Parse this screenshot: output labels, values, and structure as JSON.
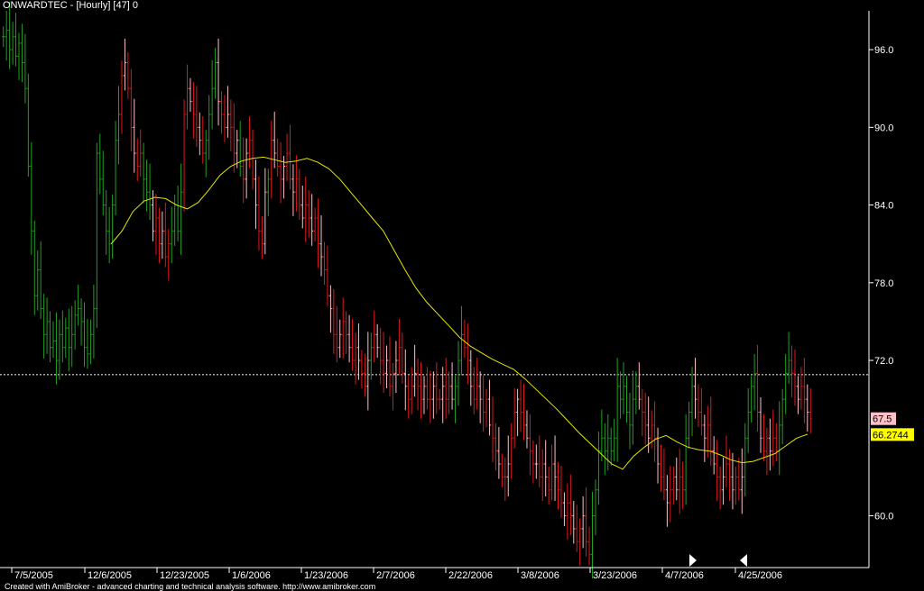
{
  "title": "ONWARDTEC - [Hourly]  [47] 0",
  "footer": "Created with AmiBroker - advanced charting and technical analysis software. http://www.amibroker.com",
  "colors": {
    "up": "#1fa01f",
    "down": "#e01818",
    "down_light": "#ffc0c8",
    "ma": "#e6e600",
    "axis": "#ffffff",
    "dotted": "#ffffff"
  },
  "chart_data": {
    "type": "line",
    "ylim": [
      56.0,
      99.0
    ],
    "yticks": [
      "96.0",
      "90.0",
      "84.0",
      "78.0",
      "72.0",
      "60.0"
    ],
    "yticks_values": [
      96.0,
      90.0,
      84.0,
      78.0,
      72.0,
      60.0
    ],
    "xticks": [
      "7/5/2005",
      "12/6/2005",
      "12/23/2005",
      "1/6/2006",
      "1/23/2006",
      "2/7/2006",
      "2/22/2006",
      "3/8/2006",
      "3/23/2006",
      "4/7/2006",
      "4/25/2006"
    ],
    "reference_line": 70.9,
    "last_close": "67.5",
    "last_ma": "66.2744",
    "series": [
      {
        "kind": "price",
        "points": [
          [
            97,
            "u"
          ],
          [
            97.5,
            "u"
          ],
          [
            96,
            "u"
          ],
          [
            97,
            "u"
          ],
          [
            95.5,
            "u"
          ],
          [
            96.5,
            "u"
          ],
          [
            95,
            "u"
          ],
          [
            93,
            "u"
          ],
          [
            87,
            "u"
          ],
          [
            82,
            "u"
          ],
          [
            77,
            "u"
          ],
          [
            79,
            "u"
          ],
          [
            76,
            "u"
          ],
          [
            74,
            "u"
          ],
          [
            75,
            "u"
          ],
          [
            73,
            "u"
          ],
          [
            73.5,
            "u"
          ],
          [
            72,
            "u"
          ],
          [
            74,
            "u"
          ],
          [
            73,
            "u"
          ],
          [
            74.5,
            "u"
          ],
          [
            73,
            "u"
          ],
          [
            74,
            "u"
          ],
          [
            75.5,
            "u"
          ],
          [
            76,
            "u"
          ],
          [
            75,
            "u"
          ],
          [
            73,
            "u"
          ],
          [
            72.5,
            "u"
          ],
          [
            74,
            "u"
          ],
          [
            76,
            "u"
          ],
          [
            88,
            "u"
          ],
          [
            86,
            "u"
          ],
          [
            84,
            "u"
          ],
          [
            82,
            "u"
          ],
          [
            81,
            "u"
          ],
          [
            84,
            "u"
          ],
          [
            89,
            "u"
          ],
          [
            91,
            "u"
          ],
          [
            94,
            "d"
          ],
          [
            95,
            "d"
          ],
          [
            93,
            "d"
          ],
          [
            90,
            "d"
          ],
          [
            88,
            "d"
          ],
          [
            87,
            "d"
          ],
          [
            88,
            "d"
          ],
          [
            86,
            "u"
          ],
          [
            85,
            "u"
          ],
          [
            84,
            "u"
          ],
          [
            82,
            "d"
          ],
          [
            83,
            "d"
          ],
          [
            81,
            "d"
          ],
          [
            82,
            "d"
          ],
          [
            80,
            "d"
          ],
          [
            81,
            "d"
          ],
          [
            82,
            "u"
          ],
          [
            84,
            "u"
          ],
          [
            82,
            "u"
          ],
          [
            85,
            "u"
          ],
          [
            91,
            "d"
          ],
          [
            93,
            "d"
          ],
          [
            92,
            "d"
          ],
          [
            91,
            "d"
          ],
          [
            90,
            "d"
          ],
          [
            89,
            "d"
          ],
          [
            88,
            "d"
          ],
          [
            89,
            "u"
          ],
          [
            91,
            "u"
          ],
          [
            93,
            "u"
          ],
          [
            95,
            "u"
          ],
          [
            92,
            "d"
          ],
          [
            91,
            "d"
          ],
          [
            90,
            "d"
          ],
          [
            91,
            "d"
          ],
          [
            90,
            "d"
          ],
          [
            88,
            "d"
          ],
          [
            89,
            "d"
          ],
          [
            87,
            "u"
          ],
          [
            86,
            "d"
          ],
          [
            88,
            "d"
          ],
          [
            89,
            "d"
          ],
          [
            86,
            "d"
          ],
          [
            84,
            "d"
          ],
          [
            82,
            "d"
          ],
          [
            81,
            "d"
          ],
          [
            85,
            "d"
          ],
          [
            86,
            "u"
          ],
          [
            89,
            "d"
          ],
          [
            88,
            "d"
          ],
          [
            87,
            "d"
          ],
          [
            86,
            "d"
          ],
          [
            87,
            "d"
          ],
          [
            88,
            "d"
          ],
          [
            86,
            "d"
          ],
          [
            85,
            "d"
          ],
          [
            86,
            "d"
          ],
          [
            84,
            "d"
          ],
          [
            83,
            "d"
          ],
          [
            84,
            "d"
          ],
          [
            83,
            "d"
          ],
          [
            82,
            "d"
          ],
          [
            83,
            "d"
          ],
          [
            81,
            "d"
          ],
          [
            80,
            "d"
          ],
          [
            79,
            "d"
          ],
          [
            77,
            "d"
          ],
          [
            76,
            "d"
          ],
          [
            74,
            "d"
          ],
          [
            73,
            "d"
          ],
          [
            74,
            "d"
          ],
          [
            75,
            "d"
          ],
          [
            74,
            "d"
          ],
          [
            73,
            "d"
          ],
          [
            72,
            "d"
          ],
          [
            73,
            "d"
          ],
          [
            72,
            "d"
          ],
          [
            71,
            "d"
          ],
          [
            70,
            "d"
          ],
          [
            72,
            "d"
          ],
          [
            73,
            "u"
          ],
          [
            74,
            "d"
          ],
          [
            73,
            "d"
          ],
          [
            72,
            "d"
          ],
          [
            71,
            "d"
          ],
          [
            72,
            "d"
          ],
          [
            70,
            "d"
          ],
          [
            71,
            "d"
          ],
          [
            72,
            "d"
          ],
          [
            73,
            "d"
          ],
          [
            71,
            "d"
          ],
          [
            70,
            "d"
          ],
          [
            69,
            "d"
          ],
          [
            70,
            "d"
          ],
          [
            71,
            "d"
          ],
          [
            70,
            "d"
          ],
          [
            69,
            "d"
          ],
          [
            70,
            "d"
          ],
          [
            69,
            "d"
          ],
          [
            69,
            "d"
          ],
          [
            70,
            "d"
          ],
          [
            69,
            "d"
          ],
          [
            69,
            "d"
          ],
          [
            70,
            "d"
          ],
          [
            69,
            "d"
          ],
          [
            70,
            "d"
          ],
          [
            69,
            "d"
          ],
          [
            70,
            "u"
          ],
          [
            72,
            "u"
          ],
          [
            74,
            "u"
          ],
          [
            73,
            "d"
          ],
          [
            72,
            "d"
          ],
          [
            70,
            "d"
          ],
          [
            69,
            "d"
          ],
          [
            70,
            "d"
          ],
          [
            69,
            "d"
          ],
          [
            68,
            "d"
          ],
          [
            69,
            "d"
          ],
          [
            67,
            "d"
          ],
          [
            66,
            "d"
          ],
          [
            65,
            "d"
          ],
          [
            64,
            "d"
          ],
          [
            63,
            "d"
          ],
          [
            63,
            "d"
          ],
          [
            64,
            "d"
          ],
          [
            66,
            "d"
          ],
          [
            68,
            "d"
          ],
          [
            69,
            "d"
          ],
          [
            68,
            "d"
          ],
          [
            67,
            "d"
          ],
          [
            66,
            "d"
          ],
          [
            65,
            "d"
          ],
          [
            64,
            "d"
          ],
          [
            64,
            "d"
          ],
          [
            63,
            "d"
          ],
          [
            64,
            "d"
          ],
          [
            63,
            "d"
          ],
          [
            62,
            "d"
          ],
          [
            64,
            "d"
          ],
          [
            63,
            "d"
          ],
          [
            62,
            "d"
          ],
          [
            61,
            "d"
          ],
          [
            60,
            "d"
          ],
          [
            61,
            "d"
          ],
          [
            60,
            "d"
          ],
          [
            59,
            "d"
          ],
          [
            58,
            "d"
          ],
          [
            59,
            "d"
          ],
          [
            60,
            "d"
          ],
          [
            58,
            "d"
          ],
          [
            57,
            "d"
          ],
          [
            60,
            "u"
          ],
          [
            62,
            "u"
          ],
          [
            65,
            "u"
          ],
          [
            66,
            "u"
          ],
          [
            65,
            "u"
          ],
          [
            66,
            "u"
          ],
          [
            65,
            "u"
          ],
          [
            66,
            "u"
          ],
          [
            70,
            "u"
          ],
          [
            69,
            "u"
          ],
          [
            70,
            "u"
          ],
          [
            68,
            "u"
          ],
          [
            67,
            "u"
          ],
          [
            69,
            "u"
          ],
          [
            70,
            "u"
          ],
          [
            69,
            "d"
          ],
          [
            68,
            "d"
          ],
          [
            67,
            "d"
          ],
          [
            66,
            "d"
          ],
          [
            67,
            "d"
          ],
          [
            66,
            "d"
          ],
          [
            64,
            "d"
          ],
          [
            63,
            "d"
          ],
          [
            62,
            "d"
          ],
          [
            61,
            "d"
          ],
          [
            62,
            "d"
          ],
          [
            63,
            "d"
          ],
          [
            62,
            "d"
          ],
          [
            63,
            "d"
          ],
          [
            62,
            "d"
          ],
          [
            66,
            "u"
          ],
          [
            68,
            "u"
          ],
          [
            70,
            "u"
          ],
          [
            69,
            "d"
          ],
          [
            68,
            "d"
          ],
          [
            67,
            "d"
          ],
          [
            66,
            "d"
          ],
          [
            67,
            "d"
          ],
          [
            65,
            "d"
          ],
          [
            64,
            "d"
          ],
          [
            63,
            "d"
          ],
          [
            62,
            "d"
          ],
          [
            63,
            "d"
          ],
          [
            64,
            "d"
          ],
          [
            63,
            "d"
          ],
          [
            62,
            "d"
          ],
          [
            63,
            "d"
          ],
          [
            62,
            "d"
          ],
          [
            63,
            "d"
          ],
          [
            66,
            "u"
          ],
          [
            68,
            "u"
          ],
          [
            70,
            "u"
          ],
          [
            71,
            "u"
          ],
          [
            68,
            "d"
          ],
          [
            66,
            "d"
          ],
          [
            65,
            "d"
          ],
          [
            66,
            "d"
          ],
          [
            65,
            "d"
          ],
          [
            66,
            "d"
          ],
          [
            65,
            "d"
          ],
          [
            67,
            "u"
          ],
          [
            69,
            "u"
          ],
          [
            71,
            "u"
          ],
          [
            72,
            "u"
          ],
          [
            71,
            "d"
          ],
          [
            70,
            "d"
          ],
          [
            69,
            "d"
          ],
          [
            70,
            "d"
          ],
          [
            69,
            "d"
          ],
          [
            68,
            "d"
          ],
          [
            67.5,
            "d"
          ]
        ],
        "markers": [
          {
            "point": [
              86,
              "u"
            ],
            "dir": "right"
          },
          {
            "point": [
              262,
              "u"
            ],
            "dir": "left"
          }
        ]
      },
      {
        "kind": "ma",
        "points": [
          81,
          82,
          83.5,
          84.3,
          84.6,
          84.5,
          84,
          83.7,
          84.2,
          85.2,
          86.3,
          87,
          87.4,
          87.6,
          87.7,
          87.5,
          87.3,
          87.4,
          87.6,
          87.3,
          86.8,
          86,
          85,
          84,
          83,
          82,
          80.5,
          79,
          77.6,
          76.5,
          75.6,
          74.7,
          73.8,
          73.1,
          72.6,
          72.1,
          71.7,
          71.3,
          70.6,
          69.8,
          69,
          68.2,
          67.3,
          66.4,
          65.6,
          64.8,
          64,
          63.6,
          64.6,
          65.3,
          65.9,
          66.2,
          65.7,
          65.3,
          65.1,
          65,
          64.7,
          64.3,
          64.1,
          64.2,
          64.5,
          64.8,
          65.4,
          66,
          66.3
        ]
      }
    ]
  }
}
